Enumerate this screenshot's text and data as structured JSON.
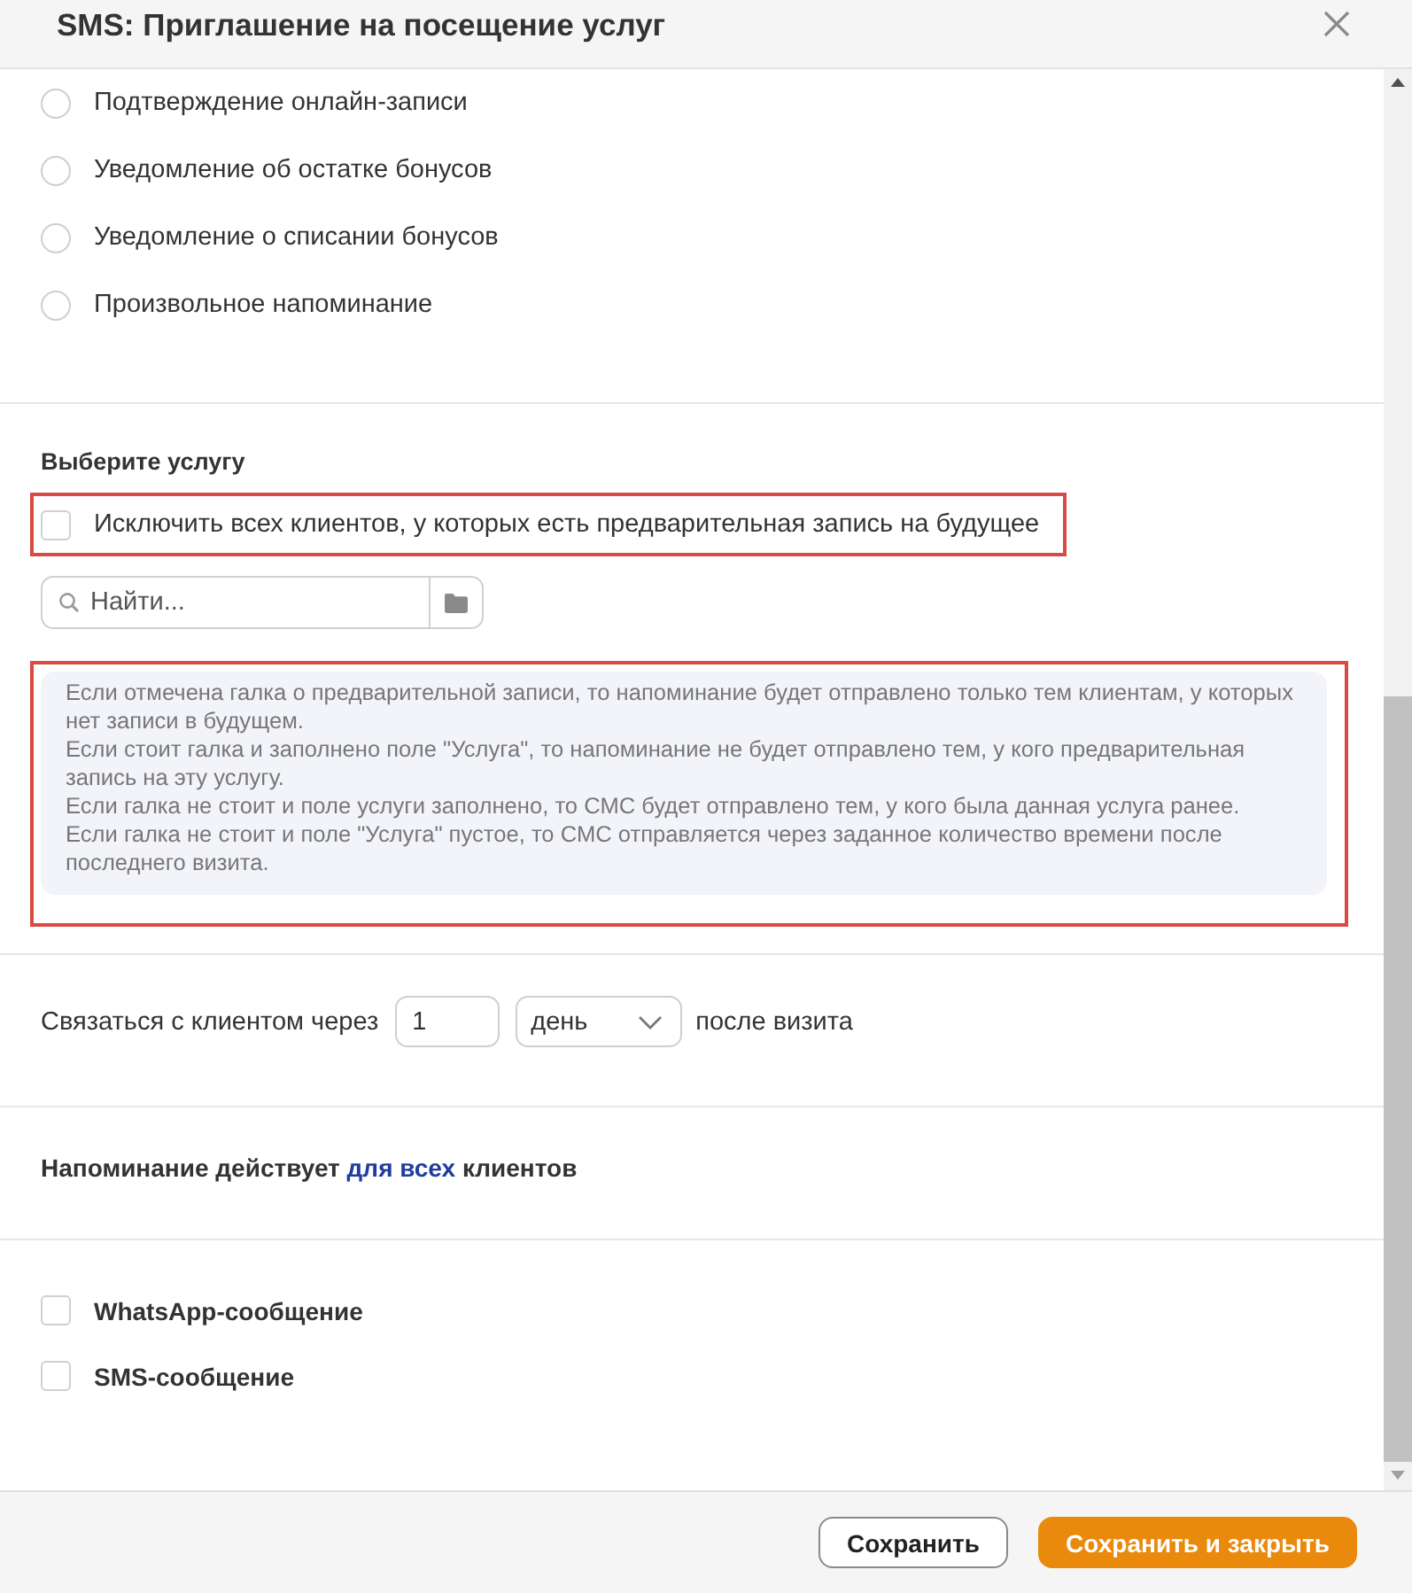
{
  "dialog": {
    "title": "SMS: Приглашение на посещение услуг"
  },
  "template_options": [
    {
      "label": "Подтверждение онлайн-записи",
      "selected": false
    },
    {
      "label": "Уведомление об остатке бонусов",
      "selected": false
    },
    {
      "label": "Уведомление о списании бонусов",
      "selected": false
    },
    {
      "label": "Произвольное напоминание",
      "selected": false
    }
  ],
  "service_section": {
    "heading": "Выберите услугу",
    "exclude_option": {
      "label": "Исключить всех клиентов, у которых есть предварительная запись на будущее",
      "checked": false,
      "highlighted": true
    },
    "search": {
      "placeholder": "Найти..."
    },
    "note": {
      "highlighted": true,
      "paragraphs": [
        "Если отмечена галка о предварительной записи, то напоминание будет отправлено только тем клиентам, у которых нет записи в будущем.",
        "Если стоит галка и заполнено поле \"Услуга\", то напоминание не будет отправлено тем, у кого предварительная запись на эту услугу.",
        "Если галка не стоит и поле услуги заполнено, то СМС будет отправлено тем, у кого была данная услуга ранее.",
        "Если галка не стоит и поле \"Услуга\" пустое, то СМС отправляется через заданное количество времени после последнего визита."
      ]
    }
  },
  "contact_delay": {
    "label_before": "Связаться с клиентом через",
    "amount": "1",
    "unit": "день",
    "label_after": "после визита"
  },
  "scope": {
    "prefix": "Напоминание действует",
    "link": "для всех",
    "suffix": "клиентов"
  },
  "channels": [
    {
      "label": "WhatsApp-сообщение",
      "checked": false
    },
    {
      "label": "SMS-сообщение",
      "checked": false
    }
  ],
  "buttons": [
    {
      "label": "Сохранить",
      "kind": "secondary"
    },
    {
      "label": "Сохранить и закрыть",
      "kind": "primary"
    }
  ]
}
